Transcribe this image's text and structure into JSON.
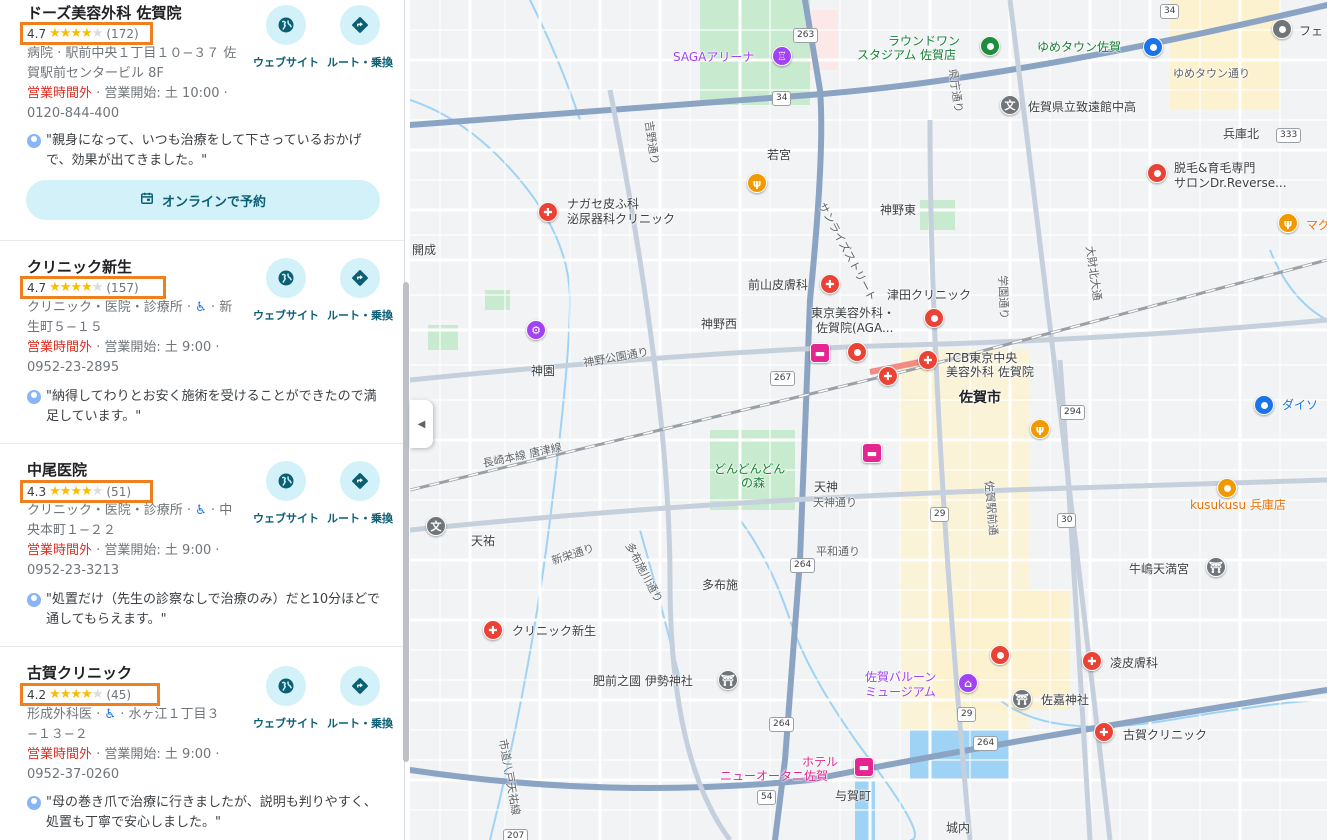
{
  "results": [
    {
      "title": "ドーズ美容外科 佐賀院",
      "rating": "4.7",
      "stars": 4.5,
      "count": "(172)",
      "info1": "病院 · 駅前中央１丁目１０−３７ 佐",
      "info2": "賀駅前センタービル 8F",
      "closed": "営業時間外",
      "opens": " · 営業開始: 土 10:00 ·",
      "phone": "0120-844-400",
      "quote": "\"親身になって、いつも治療をして下さっているおかげで、効果が出てきました。\"",
      "website": "ウェブサイト",
      "route": "ルート・乗換",
      "booking": "オンラインで予約"
    },
    {
      "title": "クリニック新生",
      "rating": "4.7",
      "stars": 4.5,
      "count": "(157)",
      "info1a": "クリニック・医院・診療所 · ",
      "info1b": " · 新",
      "info2": "生町５−１５",
      "closed": "営業時間外",
      "opens": " · 営業開始: 土 9:00 ·",
      "phone": "0952-23-2895",
      "quote": "\"納得してわりとお安く施術を受けることができたので満足しています。\"",
      "website": "ウェブサイト",
      "route": "ルート・乗換"
    },
    {
      "title": "中尾医院",
      "rating": "4.3",
      "stars": 4.5,
      "count": "(51)",
      "info1a": "クリニック・医院・診療所 · ",
      "info1b": " · 中",
      "info2": "央本町１−２２",
      "closed": "営業時間外",
      "opens": " · 営業開始: 土 9:00 ·",
      "phone": "0952-23-3213",
      "quote": "\"処置だけ（先生の診察なしで治療のみ）だと10分ほどで通してもらえます。\"",
      "website": "ウェブサイト",
      "route": "ルート・乗換"
    },
    {
      "title": "古賀クリニック",
      "rating": "4.2",
      "stars": 4,
      "count": "(45)",
      "info1a": "形成外科医 · ",
      "info1b": " · 水ヶ江１丁目３",
      "info2": "−１３−２",
      "closed": "営業時間外",
      "opens": " · 営業開始: 土 9:00 ·",
      "phone": "0952-37-0260",
      "quote": "\"母の巻き爪で治療に行きましたが、説明も判りやすく、処置も丁寧で安心しました。\"",
      "website": "ウェブサイト",
      "route": "ルート・乗換"
    }
  ],
  "accessibility_icon": "♿",
  "map": {
    "labels": {
      "saga_arena": "SAGAアリーナ",
      "roundone": "ラウンドワン",
      "roundone2": "スタジアム 佐賀店",
      "youme": "ゆめタウン佐賀",
      "youme_road": "ゆめタウン通り",
      "chienkan": "佐賀県立致遠館中高",
      "hyogokita": "兵庫北",
      "datsumo1": "脱毛&育毛専門",
      "datsumo2": "サロンDr.Reverse...",
      "wakamiya": "若宮",
      "sunrise": "サンライズストリート",
      "kannohigashi": "神野東",
      "nagase1": "ナガセ皮ふ科",
      "nagase2": "泌尿器科クリニック",
      "kaisei": "開成",
      "maeyama": "前山皮膚科",
      "tsuda": "津田クリニック",
      "tokyo1": "東京美容外科・",
      "tokyo2": "佐賀院(AGA...",
      "kannonishi": "神野西",
      "kannokoen": "神野公園通り",
      "tcb1": "TCB東京中央",
      "tcb2": "美容外科 佐賀院",
      "jinen": "神園",
      "sagashi": "佐賀市",
      "nagasaki": "長崎本線 唐津線",
      "dondon1": "どんどんどん",
      "dondon2": "の森",
      "tenjin": "天神",
      "tenjindori": "天神通り",
      "kusukusu": "kusukusu 兵庫店",
      "tenyu": "天祐",
      "shinei": "新栄通り",
      "heiwa": "平和通り",
      "tafuse": "多布施",
      "tafusegawa": "多布施川通り",
      "ushijima": "牛嶋天満宮",
      "clinic_shinsei": "クリニック新生",
      "ryo": "凌皮膚科",
      "balloon1": "佐賀バルーン",
      "balloon2": "ミュージアム",
      "hizen": "肥前之國 伊勢神社",
      "sagajinja": "佐嘉神社",
      "koga": "古賀クリニック",
      "hotel1": "ホテル",
      "hotel2": "ニューオータニ佐賀",
      "yokamachi": "与賀町",
      "jonai": "城内",
      "daizai": "大財北大通",
      "gakuen": "学園通り",
      "sagaekimae": "佐賀駅前通",
      "daiso": "ダイソ",
      "mag": "マグ",
      "fe": "フェ",
      "kenbe": "県庁通り",
      "yoshino": "吉野通り",
      "shinto": "市道八戸天祐線"
    },
    "road_shields": [
      "34",
      "263",
      "34",
      "333",
      "267",
      "294",
      "29",
      "30",
      "264",
      "29",
      "264",
      "54",
      "207",
      "264"
    ],
    "arena_icon": "♖"
  }
}
